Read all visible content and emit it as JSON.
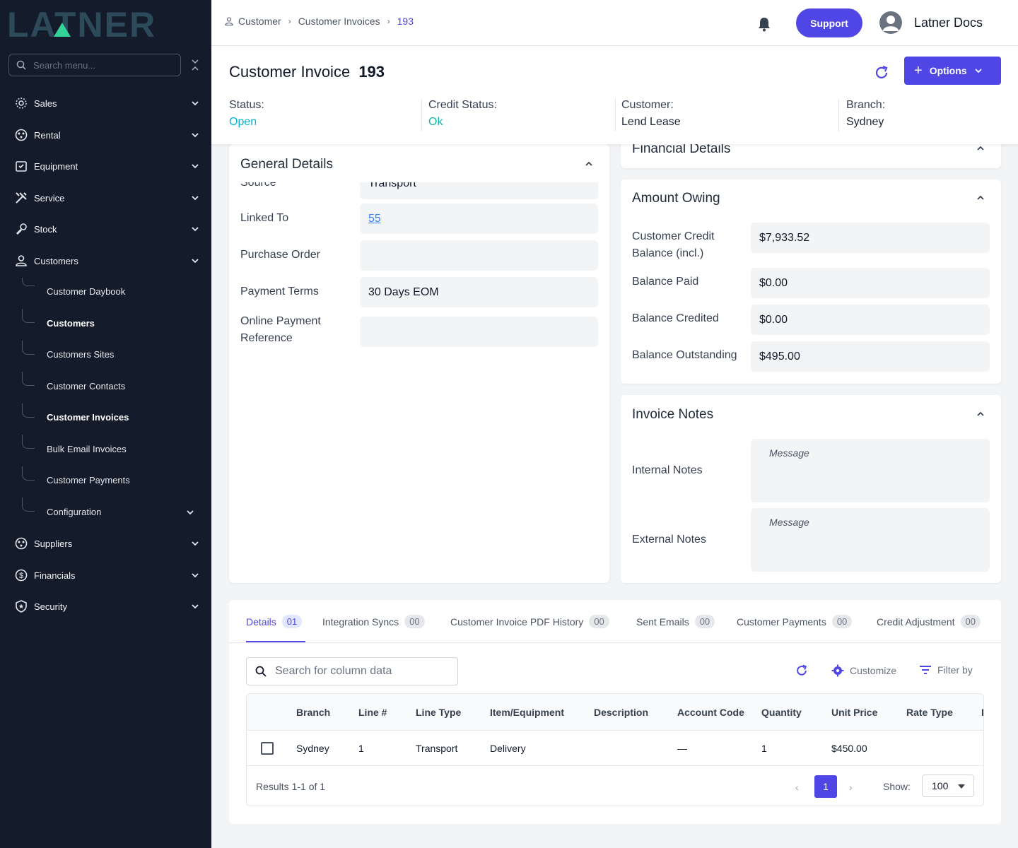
{
  "brand": {
    "logo_text": "LATNER"
  },
  "sidebar": {
    "search_placeholder": "Search menu...",
    "items": [
      {
        "label": "Sales",
        "icon": "sales-icon"
      },
      {
        "label": "Rental",
        "icon": "rental-icon"
      },
      {
        "label": "Equipment",
        "icon": "equipment-icon"
      },
      {
        "label": "Service",
        "icon": "service-icon"
      },
      {
        "label": "Stock",
        "icon": "stock-icon"
      },
      {
        "label": "Customers",
        "icon": "user-icon"
      },
      {
        "label": "Suppliers",
        "icon": "suppliers-icon"
      },
      {
        "label": "Financials",
        "icon": "financials-icon"
      },
      {
        "label": "Security",
        "icon": "shield-icon"
      }
    ],
    "customers_sub": [
      {
        "label": "Customer Daybook"
      },
      {
        "label": "Customers"
      },
      {
        "label": "Customers Sites"
      },
      {
        "label": "Customer Contacts"
      },
      {
        "label": "Customer Invoices"
      },
      {
        "label": "Bulk Email Invoices"
      },
      {
        "label": "Customer Payments"
      },
      {
        "label": "Configuration"
      }
    ]
  },
  "topbar": {
    "breadcrumb": [
      "Customer",
      "Customer Invoices",
      "193"
    ],
    "support_label": "Support",
    "user_name": "Latner Docs"
  },
  "header": {
    "title": "Customer Invoice",
    "number": "193",
    "options_label": "Options",
    "status": {
      "label": "Status:",
      "value": "Open"
    },
    "credit_status": {
      "label": "Credit Status:",
      "value": "Ok"
    },
    "customer": {
      "label": "Customer:",
      "value": "Lend Lease"
    },
    "branch": {
      "label": "Branch:",
      "value": "Sydney"
    }
  },
  "general": {
    "title": "General Details",
    "source_label": "Source",
    "source_value": "Transport",
    "linked_label": "Linked To",
    "linked_value": "55",
    "po_label": "Purchase Order",
    "po_value": "",
    "terms_label": "Payment Terms",
    "terms_value": "30 Days EOM",
    "online_label_1": "Online Payment",
    "online_label_2": "Reference",
    "online_value": ""
  },
  "financial": {
    "title": "Financial Details"
  },
  "owing": {
    "title": "Amount Owing",
    "credit_label_1": "Customer Credit",
    "credit_label_2": "Balance (incl.)",
    "credit_value": "$7,933.52",
    "paid_label": "Balance Paid",
    "paid_value": "$0.00",
    "credited_label": "Balance Credited",
    "credited_value": "$0.00",
    "outstanding_label": "Balance Outstanding",
    "outstanding_value": "$495.00"
  },
  "notes": {
    "title": "Invoice Notes",
    "internal_label": "Internal Notes",
    "external_label": "External Notes",
    "placeholder": "Message"
  },
  "tabs": [
    {
      "label": "Details",
      "count": "01"
    },
    {
      "label": "Integration Syncs",
      "count": "00"
    },
    {
      "label": "Customer Invoice PDF History",
      "count": "00"
    },
    {
      "label": "Sent Emails",
      "count": "00"
    },
    {
      "label": "Customer Payments",
      "count": "00"
    },
    {
      "label": "Credit Adjustment",
      "count": "00"
    }
  ],
  "table": {
    "search_placeholder": "Search for column data",
    "customize_label": "Customize",
    "filter_label": "Filter by",
    "columns": [
      "Branch",
      "Line #",
      "Line Type",
      "Item/Equipment",
      "Description",
      "Account Code",
      "Quantity",
      "Unit Price",
      "Rate Type",
      "I"
    ],
    "rows": [
      {
        "branch": "Sydney",
        "line": "1",
        "type": "Transport",
        "item": "Delivery",
        "description": "",
        "account": "—",
        "qty": "1",
        "price": "$450.00",
        "rate": ""
      }
    ],
    "results": "Results 1-1 of 1",
    "page": "1",
    "show_label": "Show:",
    "show_value": "100"
  },
  "colors": {
    "accent": "#4f46e5",
    "sidebar": "#141c2b",
    "open": "#06b6d4",
    "ok": "#14b8a6"
  }
}
